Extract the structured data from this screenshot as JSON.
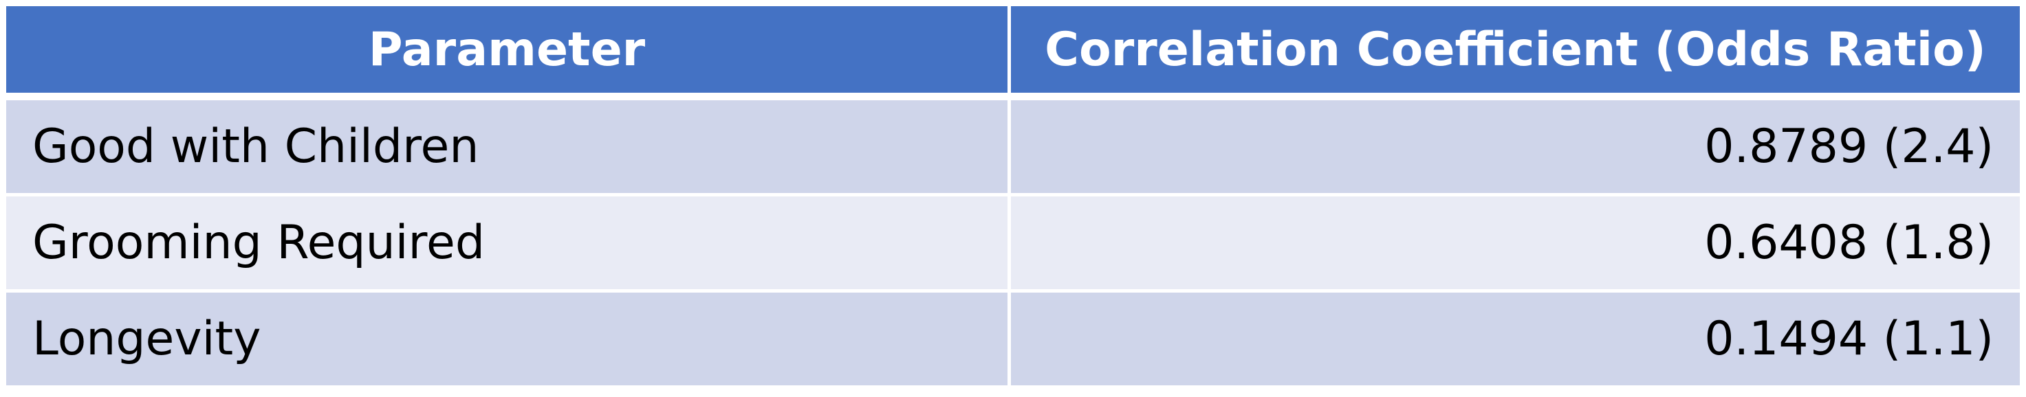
{
  "table": {
    "headers": {
      "parameter": "Parameter",
      "coefficient": "Correlation Coefficient (Odds Ratio)"
    },
    "rows": [
      {
        "parameter": "Good with Children",
        "coefficient": "0.8789 (2.4)"
      },
      {
        "parameter": "Grooming Required",
        "coefficient": "0.6408 (1.8)"
      },
      {
        "parameter": "Longevity",
        "coefficient": "0.1494 (1.1)"
      }
    ]
  },
  "colors": {
    "header_background": "#4472c4",
    "header_text": "#ffffff",
    "row_band_a": "#cfd5ea",
    "row_band_b": "#e9ebf5",
    "cell_text": "#000000",
    "grid_lines": "#ffffff"
  }
}
